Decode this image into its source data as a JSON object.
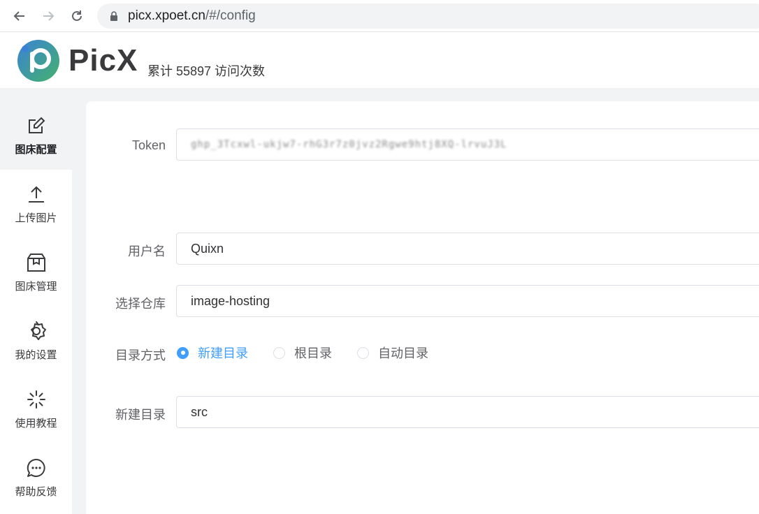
{
  "browser": {
    "url_host": "picx.xpoet.cn",
    "url_path": "/#/config",
    "icons": [
      "back-arrow-icon",
      "forward-arrow-icon",
      "reload-icon",
      "lock-icon"
    ]
  },
  "header": {
    "brand": "PicX",
    "visit_text": "累计 55897 访问次数"
  },
  "sidebar": {
    "items": [
      {
        "label": "图床配置",
        "icon": "edit-icon",
        "active": true
      },
      {
        "label": "上传图片",
        "icon": "upload-icon",
        "active": false
      },
      {
        "label": "图床管理",
        "icon": "box-icon",
        "active": false
      },
      {
        "label": "我的设置",
        "icon": "gear-icon",
        "active": false
      },
      {
        "label": "使用教程",
        "icon": "sparkle-icon",
        "active": false
      },
      {
        "label": "帮助反馈",
        "icon": "chat-icon",
        "active": false
      }
    ]
  },
  "form": {
    "token_label": "Token",
    "token_value": "ghp_3Tcxwl-ukjw7-rhG3r7z0jvz2Rgwe9htj8XQ-lrvuJ3L",
    "username_label": "用户名",
    "username_value": "Quixn",
    "repo_label": "选择仓库",
    "repo_value": "image-hosting",
    "dir_mode_label": "目录方式",
    "dir_mode_options": [
      "新建目录",
      "根目录",
      "自动目录"
    ],
    "dir_mode_selected": "新建目录",
    "new_dir_label": "新建目录",
    "new_dir_value": "src"
  },
  "colors": {
    "accent": "#409eff",
    "logo_blue": "#3b82d6",
    "logo_green": "#43b26b"
  }
}
